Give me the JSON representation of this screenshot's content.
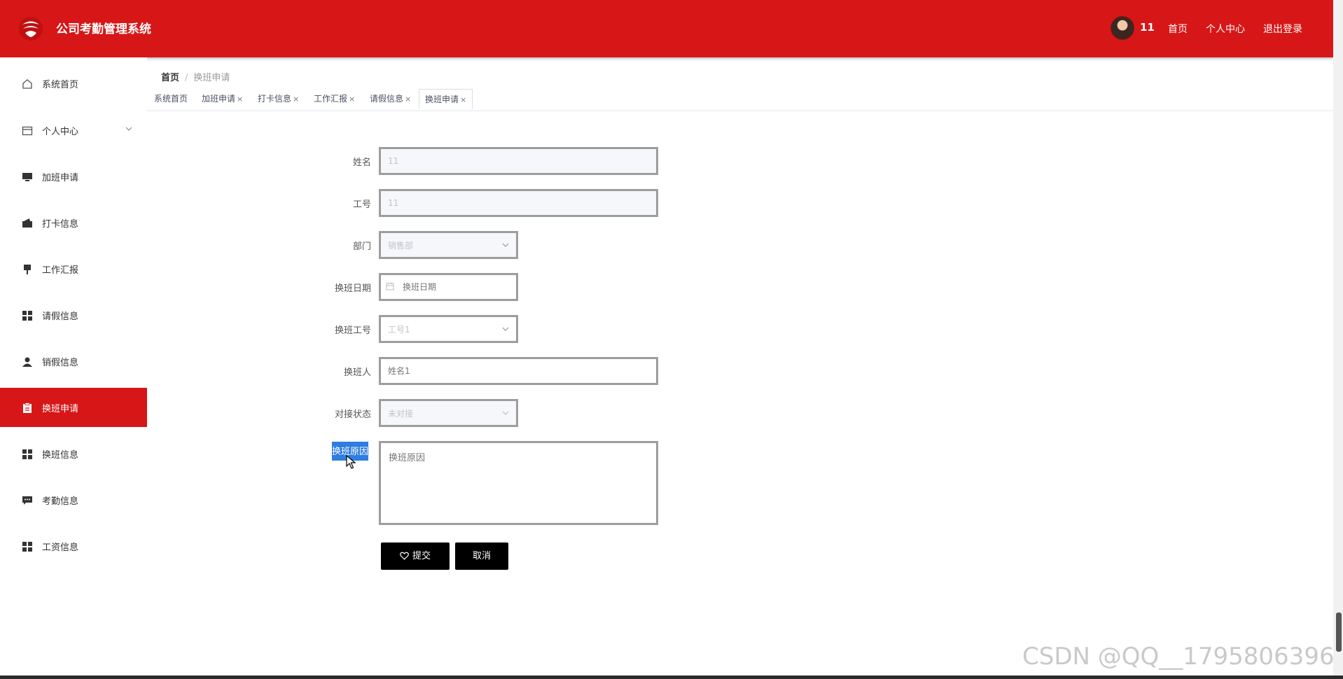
{
  "header": {
    "app_title": "公司考勤管理系统",
    "username": "11",
    "nav": [
      "首页",
      "个人中心",
      "退出登录"
    ],
    "brand_color": "#d71617"
  },
  "sidebar": {
    "items": [
      {
        "label": "系统首页",
        "icon": "home-icon"
      },
      {
        "label": "个人中心",
        "icon": "card-icon"
      },
      {
        "label": "加班申请",
        "icon": "monitor-icon"
      },
      {
        "label": "打卡信息",
        "icon": "wallet-icon"
      },
      {
        "label": "工作汇报",
        "icon": "pin-icon"
      },
      {
        "label": "请假信息",
        "icon": "grid-icon"
      },
      {
        "label": "销假信息",
        "icon": "user-icon"
      },
      {
        "label": "换班申请",
        "icon": "clipboard-icon",
        "active": true
      },
      {
        "label": "换班信息",
        "icon": "grid-icon"
      },
      {
        "label": "考勤信息",
        "icon": "chat-icon"
      },
      {
        "label": "工资信息",
        "icon": "grid-icon"
      }
    ]
  },
  "breadcrumb": {
    "home": "首页",
    "separator": "/",
    "current": "换班申请"
  },
  "tabs": [
    {
      "label": "系统首页",
      "closable": false
    },
    {
      "label": "加班申请",
      "closable": true
    },
    {
      "label": "打卡信息",
      "closable": true
    },
    {
      "label": "工作汇报",
      "closable": true
    },
    {
      "label": "请假信息",
      "closable": true
    },
    {
      "label": "换班申请",
      "closable": true,
      "active": true
    }
  ],
  "tab_close_glyph": "×",
  "form": {
    "name": {
      "label": "姓名",
      "value": "11"
    },
    "job_no": {
      "label": "工号",
      "value": "11"
    },
    "department": {
      "label": "部门",
      "value": "销售部"
    },
    "shift_date": {
      "label": "换班日期",
      "placeholder": "换班日期"
    },
    "shift_job_no": {
      "label": "换班工号",
      "value": "工号1"
    },
    "shift_person": {
      "label": "换班人",
      "placeholder": "姓名1"
    },
    "handover_status": {
      "label": "对接状态",
      "value": "未对接"
    },
    "reason": {
      "label": "换班原因",
      "placeholder": "换班原因"
    },
    "submit_label": "提交",
    "cancel_label": "取消"
  },
  "watermark": "CSDN @QQ__1795806396"
}
